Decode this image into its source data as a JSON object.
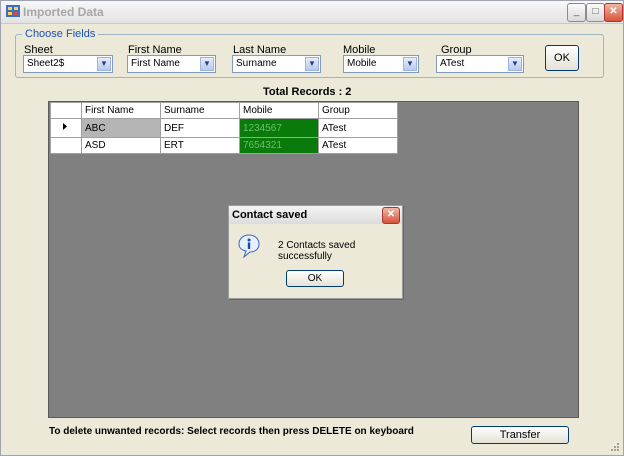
{
  "window": {
    "title": "Imported Data",
    "minimize": "_",
    "maximize": "□",
    "close": "✕"
  },
  "fields": {
    "group_label": "Choose Fields",
    "sheet": {
      "label": "Sheet",
      "value": "Sheet2$"
    },
    "first_name": {
      "label": "First Name",
      "value": "First Name"
    },
    "last_name": {
      "label": "Last Name",
      "value": "Surname"
    },
    "mobile": {
      "label": "Mobile",
      "value": "Mobile"
    },
    "group": {
      "label": "Group",
      "value": "ATest"
    },
    "ok_label": "OK"
  },
  "total_records": "Total Records : 2",
  "grid": {
    "columns": [
      "First Name",
      "Surname",
      "Mobile",
      "Group"
    ],
    "rows": [
      [
        "ABC",
        "DEF",
        "1234567",
        "ATest"
      ],
      [
        "ASD",
        "ERT",
        "7654321",
        "ATest"
      ]
    ]
  },
  "dialog": {
    "title": "Contact saved",
    "message": "2 Contacts saved successfully",
    "ok_label": "OK"
  },
  "footer": {
    "note": "To delete unwanted records: Select records then press DELETE on keyboard",
    "transfer_label": "Transfer"
  },
  "colors": {
    "mobile_cell_bg": "#0a7a0a",
    "grid_bg": "#808080",
    "window_bg": "#ece9d8"
  },
  "icons": [
    "app-icon",
    "dropdown-arrow-icon",
    "info-icon",
    "close-icon",
    "row-pointer-icon",
    "size-grip-icon"
  ]
}
